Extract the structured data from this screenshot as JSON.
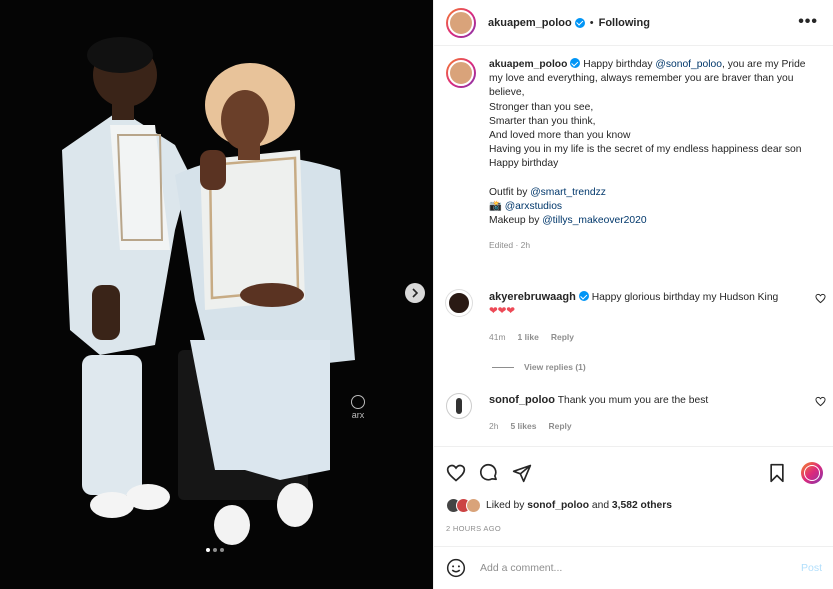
{
  "colors": {
    "brand_gradient": [
      "#f58529",
      "#dd2a7b",
      "#8134af"
    ],
    "verified": "#0095f6",
    "link": "#00376b",
    "muted": "#8e8e8e",
    "heart": "#ed4956"
  },
  "media": {
    "watermark": "arx",
    "carousel_dots": 3,
    "active_dot_index": 0,
    "next_icon": "chevron-right-icon"
  },
  "header": {
    "username": "akuapem_poloo",
    "separator": "•",
    "follow_status": "Following",
    "more_icon": "more-horizontal-icon",
    "more_label": "•••"
  },
  "caption": {
    "username": "akuapem_poloo",
    "intro": "Happy birthday",
    "mention": "@sonof_poloo",
    "lines_after_mention": ", you are my Pride my love and everything, always remember you are braver than you believe,",
    "lines": [
      "Stronger than you see,",
      "Smarter than you think,",
      "And loved more than you know",
      "Having you in my life is the secret of my endless happiness dear son",
      "Happy birthday"
    ],
    "credits": [
      {
        "prefix": "Outfit by ",
        "handle": "@smart_trendzz"
      },
      {
        "prefix": "📸 ",
        "handle": "@arxstudios"
      },
      {
        "prefix": "Makeup by ",
        "handle": "@tillys_makeover2020"
      }
    ],
    "meta": "Edited · 2h"
  },
  "comments": [
    {
      "username": "akyerebruwaagh",
      "verified": true,
      "text": "Happy glorious birthday my Hudson King",
      "emoji": "❤❤❤",
      "time": "41m",
      "likes": "1 like",
      "reply": "Reply",
      "view_replies": "View replies (1)"
    },
    {
      "username": "sonof_poloo",
      "verified": false,
      "text": "Thank you mum you are the best",
      "time": "2h",
      "likes": "5 likes",
      "reply": "Reply"
    }
  ],
  "actions": {
    "like_icon": "heart-icon",
    "comment_icon": "comment-icon",
    "share_icon": "share-icon",
    "save_icon": "bookmark-icon",
    "liked_by_prefix": "Liked by ",
    "liked_by_user": "sonof_poloo",
    "liked_by_and": " and ",
    "liked_by_others": "3,582 others",
    "time_ago": "2 HOURS AGO"
  },
  "add_comment": {
    "placeholder": "Add a comment...",
    "post_label": "Post",
    "emoji_icon": "smiley-icon"
  }
}
